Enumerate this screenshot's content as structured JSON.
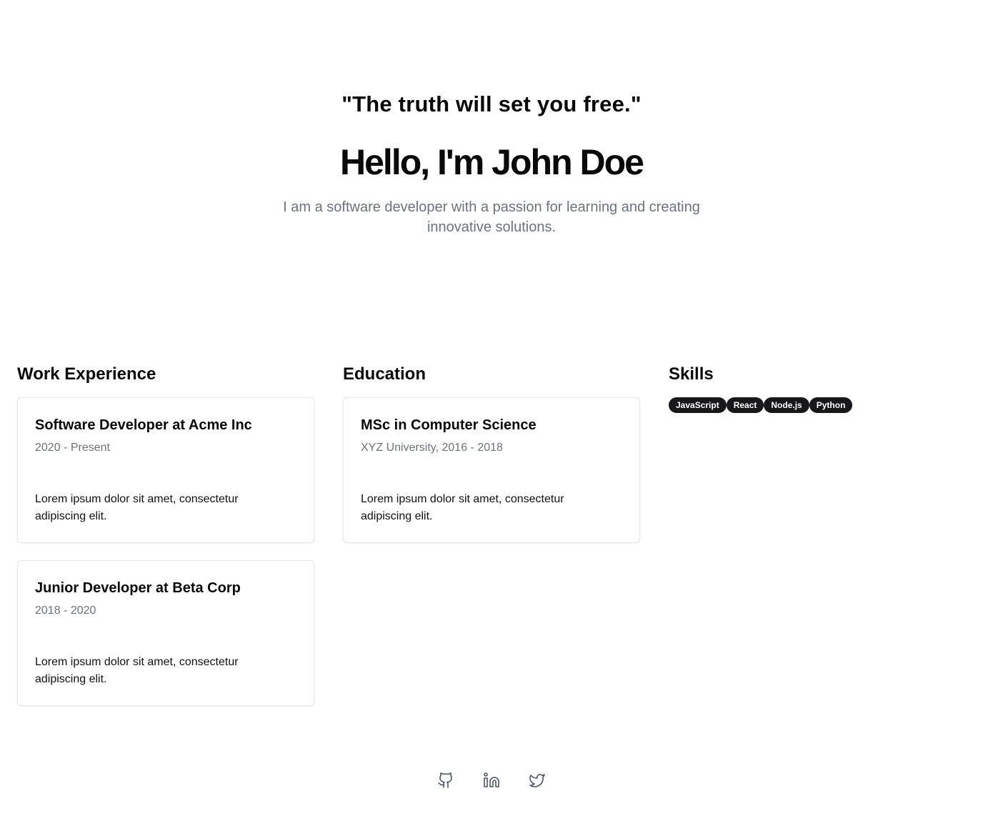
{
  "hero": {
    "quote": "\"The truth will set you free.\"",
    "title": "Hello, I'm John Doe",
    "subtitle": "I am a software developer with a passion for learning and creating innovative solutions."
  },
  "work": {
    "heading": "Work Experience",
    "jobs": [
      {
        "title": "Software Developer at Acme Inc",
        "period": "2020 - Present",
        "description": "Lorem ipsum dolor sit amet, consectetur adipiscing elit."
      },
      {
        "title": "Junior Developer at Beta Corp",
        "period": "2018 - 2020",
        "description": "Lorem ipsum dolor sit amet, consectetur adipiscing elit."
      }
    ]
  },
  "education": {
    "heading": "Education",
    "items": [
      {
        "title": "MSc in Computer Science",
        "period": "XYZ University, 2016 - 2018",
        "description": "Lorem ipsum dolor sit amet, consectetur adipiscing elit."
      }
    ]
  },
  "skills": {
    "heading": "Skills",
    "items": [
      "JavaScript",
      "React",
      "Node.js",
      "Python"
    ]
  },
  "social": {
    "icons": [
      "github-icon",
      "linkedin-icon",
      "twitter-icon"
    ]
  },
  "colors": {
    "badge_bg": "#18181b",
    "muted_text": "#6b7280",
    "card_border": "#e5e7eb"
  }
}
